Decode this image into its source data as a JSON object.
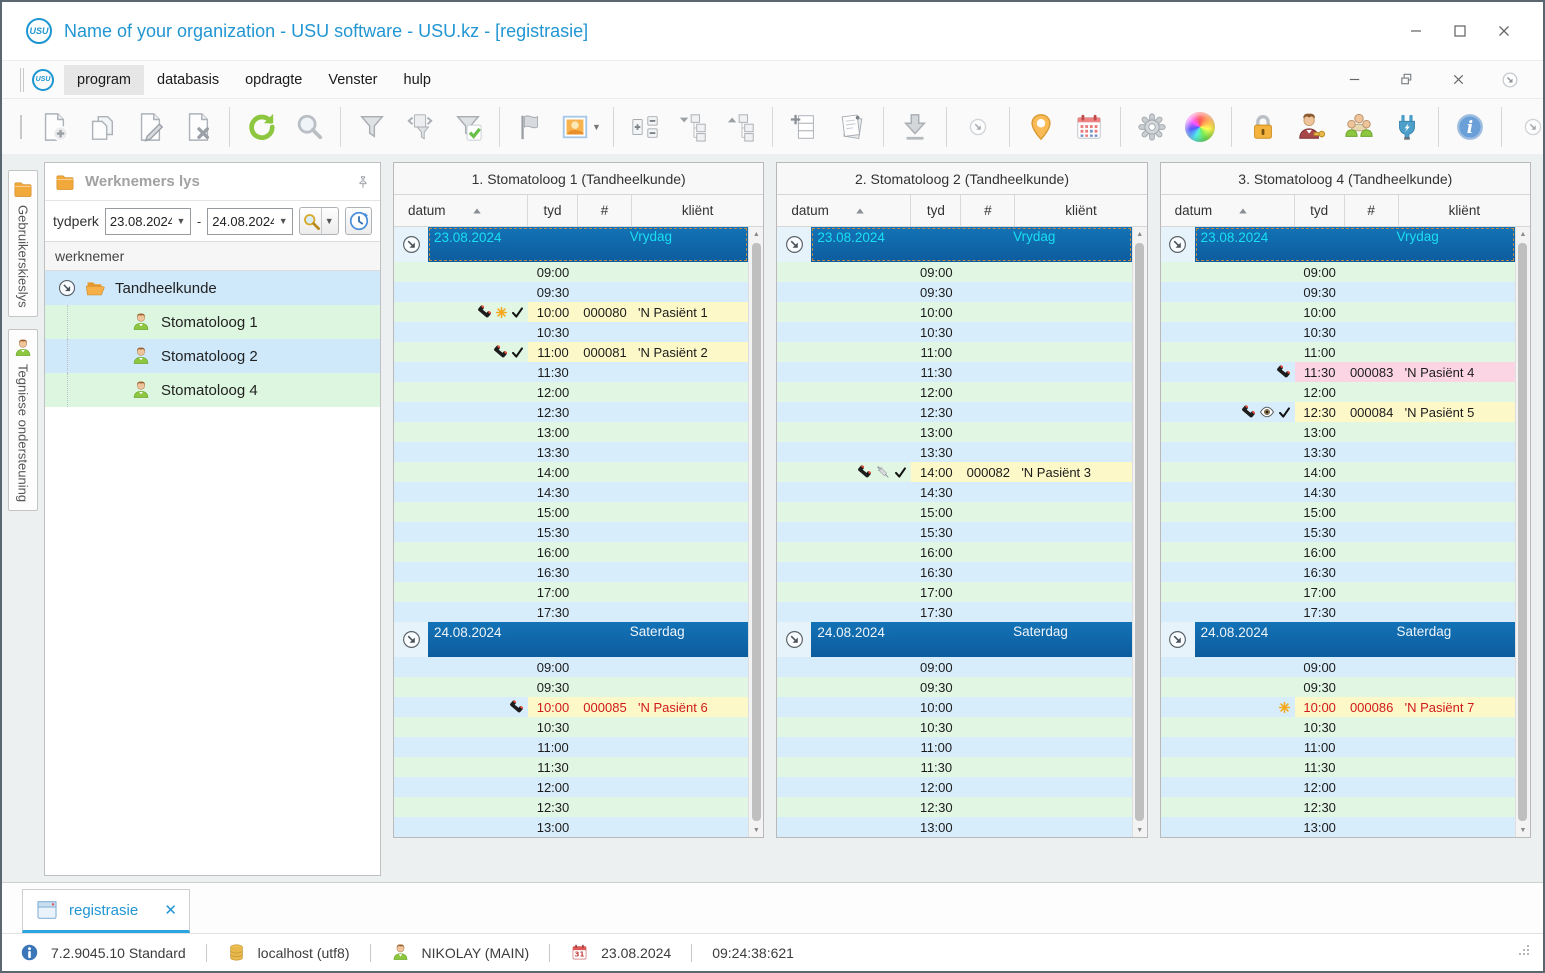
{
  "window": {
    "title": "Name of your organization - USU software - USU.kz - [registrasie]",
    "logo_text": "USU",
    "controls": [
      "minimize",
      "maximize",
      "close"
    ],
    "mdi_controls": [
      "minimize",
      "restore",
      "close",
      "more"
    ]
  },
  "menu": {
    "items": [
      {
        "label": "program",
        "active": true
      },
      {
        "label": "databasis",
        "active": false
      },
      {
        "label": "opdragte",
        "active": false
      },
      {
        "label": "Venster",
        "active": false
      },
      {
        "label": "hulp",
        "active": false
      }
    ]
  },
  "toolbar": {
    "groups": [
      [
        {
          "name": "add-record"
        },
        {
          "name": "copy-record"
        },
        {
          "name": "edit-record"
        },
        {
          "name": "delete-record"
        }
      ],
      [
        {
          "name": "refresh"
        },
        {
          "name": "search"
        }
      ],
      [
        {
          "name": "filter"
        },
        {
          "name": "filter-columns"
        },
        {
          "name": "filter-confirm"
        }
      ],
      [
        {
          "name": "flag"
        },
        {
          "name": "picture",
          "dropdown": true
        }
      ],
      [
        {
          "name": "cards"
        },
        {
          "name": "tree-collapse"
        },
        {
          "name": "tree-expand"
        }
      ],
      [
        {
          "name": "add-row"
        },
        {
          "name": "documents"
        }
      ],
      [
        {
          "name": "import"
        }
      ],
      [
        {
          "name": "more",
          "small": true
        }
      ],
      [
        {
          "name": "map-marker"
        },
        {
          "name": "calendar"
        }
      ],
      [
        {
          "name": "settings"
        },
        {
          "name": "palette"
        }
      ],
      [
        {
          "name": "lock"
        },
        {
          "name": "user-rights"
        },
        {
          "name": "users"
        },
        {
          "name": "plugins"
        }
      ],
      [
        {
          "name": "info",
          "push": true
        }
      ],
      [
        {
          "name": "more",
          "small": true
        }
      ]
    ]
  },
  "sidebar": {
    "tabs": [
      {
        "label": "Gebruikerskieslys",
        "icon": "folder"
      },
      {
        "label": "Tegniese ondersteuning",
        "icon": "person"
      }
    ],
    "panel": {
      "title": "Werknemers lys",
      "period_label": "tydperk",
      "date_from": "23.08.2024",
      "date_to": "24.08.2024",
      "period_separator": "-",
      "grid_header": "werknemer",
      "tree": [
        {
          "label": "Tandheelkunde",
          "type": "folder"
        },
        {
          "label": "Stomatoloog 1",
          "type": "person"
        },
        {
          "label": "Stomatoloog 2",
          "type": "person"
        },
        {
          "label": "Stomatoloog 4",
          "type": "person"
        }
      ]
    }
  },
  "schedule": {
    "headers": [
      "datum",
      "tyd",
      "#",
      "kliënt"
    ],
    "days": [
      {
        "date": "23.08.2024",
        "weekday": "Vrydag",
        "current": true
      },
      {
        "date": "24.08.2024",
        "weekday": "Saterdag",
        "current": false
      }
    ],
    "friday_times": [
      "09:00",
      "09:30",
      "10:00",
      "10:30",
      "11:00",
      "11:30",
      "12:00",
      "12:30",
      "13:00",
      "13:30",
      "14:00",
      "14:30",
      "15:00",
      "15:30",
      "16:00",
      "16:30",
      "17:00",
      "17:30"
    ],
    "saturday_times": [
      "09:00",
      "09:30",
      "10:00",
      "10:30",
      "11:00",
      "11:30",
      "12:00",
      "12:30",
      "13:00"
    ],
    "columns": [
      {
        "title": "1. Stomatoloog 1 (Tandheelkunde)",
        "appointments": [
          {
            "day": 0,
            "time": "10:00",
            "number": "000080",
            "client": "'N Pasiënt 1",
            "icons": [
              "phone",
              "asterisk",
              "check"
            ],
            "bg": "yellow",
            "text": "black"
          },
          {
            "day": 0,
            "time": "11:00",
            "number": "000081",
            "client": "'N Pasiënt 2",
            "icons": [
              "phone",
              "check"
            ],
            "bg": "yellow",
            "text": "black"
          },
          {
            "day": 1,
            "time": "10:00",
            "number": "000085",
            "client": "'N Pasiënt 6",
            "icons": [
              "phone"
            ],
            "bg": "yellow",
            "text": "red"
          }
        ]
      },
      {
        "title": "2. Stomatoloog 2 (Tandheelkunde)",
        "appointments": [
          {
            "day": 0,
            "time": "14:00",
            "number": "000082",
            "client": "'N Pasiënt 3",
            "icons": [
              "phone",
              "syringe",
              "check"
            ],
            "bg": "yellow",
            "text": "black"
          }
        ]
      },
      {
        "title": "3. Stomatoloog 4 (Tandheelkunde)",
        "appointments": [
          {
            "day": 0,
            "time": "11:30",
            "number": "000083",
            "client": "'N Pasiënt 4",
            "icons": [
              "phone"
            ],
            "bg": "pink",
            "text": "black"
          },
          {
            "day": 0,
            "time": "12:30",
            "number": "000084",
            "client": "'N Pasiënt 5",
            "icons": [
              "phone",
              "eye",
              "check"
            ],
            "bg": "yellow",
            "text": "black"
          },
          {
            "day": 1,
            "time": "10:00",
            "number": "000086",
            "client": "'N Pasiënt 7",
            "icons": [
              "asterisk"
            ],
            "bg": "yellow",
            "text": "red"
          }
        ]
      }
    ]
  },
  "footer": {
    "tab_label": "registrasie",
    "tab_close": "✕"
  },
  "statusbar": {
    "items": [
      {
        "icon": "info-badge",
        "text": "7.2.9045.10 Standard"
      },
      {
        "icon": "database",
        "text": "localhost (utf8)"
      },
      {
        "icon": "user",
        "text": "NIKOLAY (MAIN)"
      },
      {
        "icon": "calendar-date",
        "text": "23.08.2024"
      },
      {
        "icon": null,
        "text": "09:24:38:621"
      }
    ]
  },
  "colors": {
    "accent_blue": "#2196d3",
    "date_band_blue": "#0f68aa",
    "current_day_text": "#19dff0",
    "row_green": "#e1f6e3",
    "row_blue": "#d8edfc",
    "appointment_yellow": "#fdf8c8",
    "appointment_pink": "#fbd5e3",
    "red_text": "#cf1a1a"
  }
}
